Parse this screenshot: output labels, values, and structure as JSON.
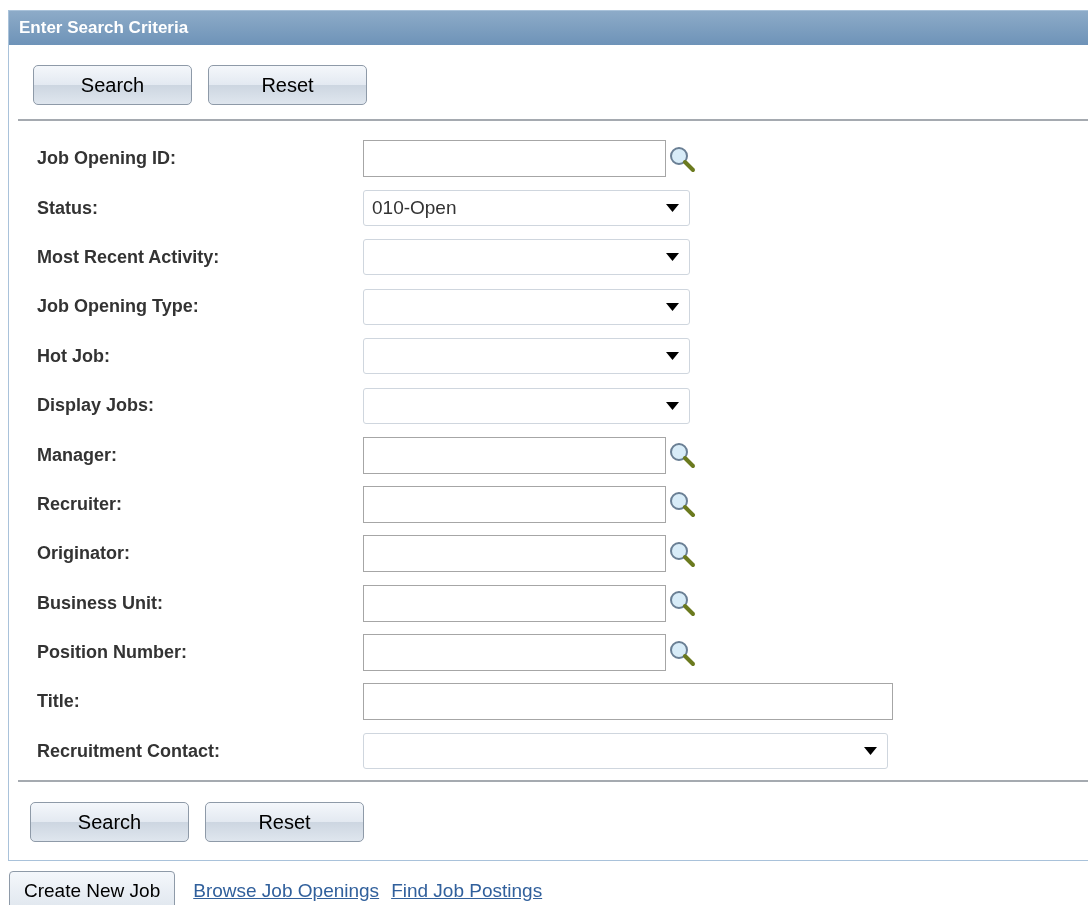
{
  "panel": {
    "title": "Enter Search Criteria"
  },
  "top_buttons": [
    "Search",
    "Reset"
  ],
  "fields": [
    {
      "label": "Job Opening ID:",
      "kind": "lookup"
    },
    {
      "label": "Status:",
      "kind": "select",
      "value": "010-Open"
    },
    {
      "label": "Most Recent Activity:",
      "kind": "select"
    },
    {
      "label": "Job Opening Type:",
      "kind": "select"
    },
    {
      "label": "Hot Job:",
      "kind": "select"
    },
    {
      "label": "Display Jobs:",
      "kind": "select"
    },
    {
      "label": "Manager:",
      "kind": "lookup"
    },
    {
      "label": "Recruiter:",
      "kind": "lookup"
    },
    {
      "label": "Originator:",
      "kind": "lookup"
    },
    {
      "label": "Business Unit:",
      "kind": "lookup"
    },
    {
      "label": "Position Number:",
      "kind": "lookup"
    },
    {
      "label": "Title:",
      "kind": "text"
    },
    {
      "label": "Recruitment Contact:",
      "kind": "wideselect"
    }
  ],
  "bottom_buttons": [
    "Search",
    "Reset"
  ],
  "footer": {
    "button": "Create New Job",
    "links": [
      "Browse Job Openings",
      "Find Job Postings"
    ]
  }
}
